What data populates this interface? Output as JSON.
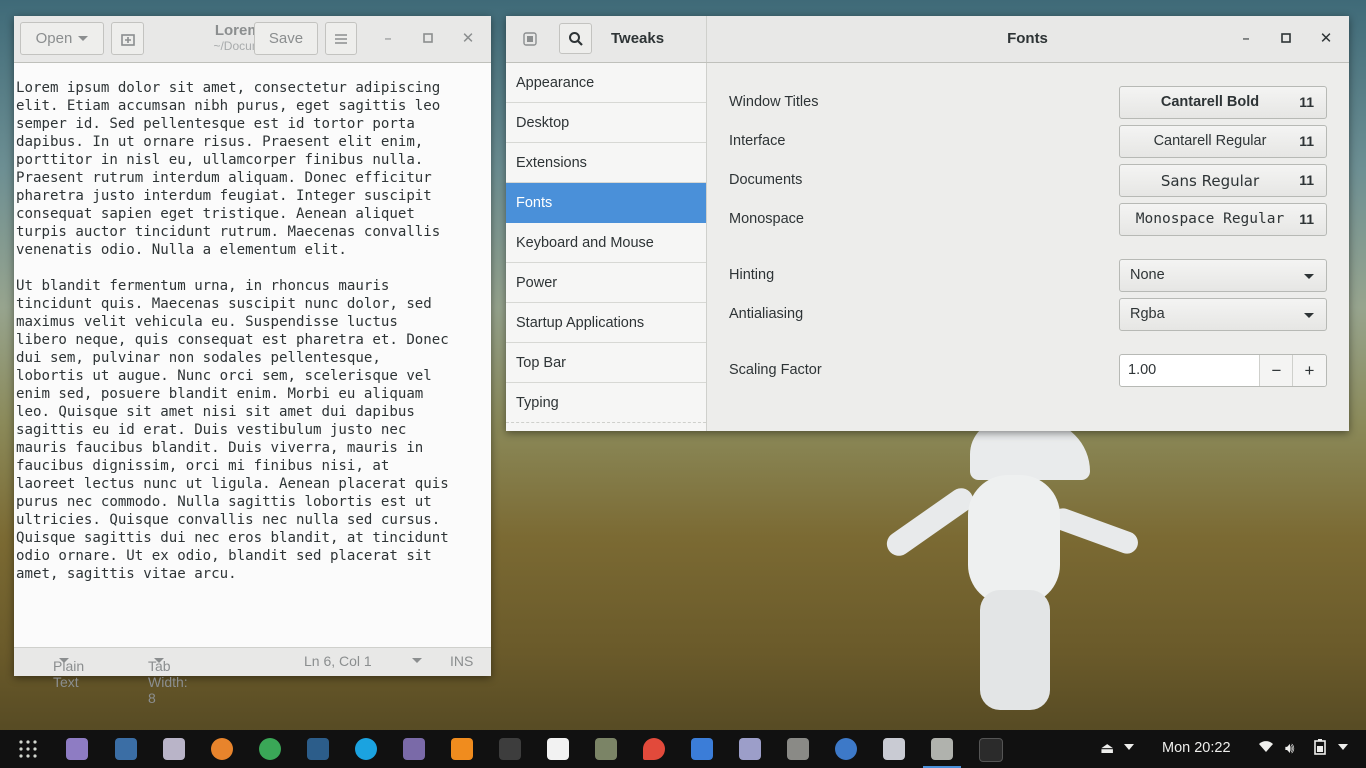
{
  "gedit": {
    "open_label": "Open",
    "save_label": "Save",
    "file_name": "Lorem.txt",
    "file_path": "~/Documents",
    "text": "Lorem ipsum dolor sit amet, consectetur adipiscing\nelit. Etiam accumsan nibh purus, eget sagittis leo\nsemper id. Sed pellentesque est id tortor porta\ndapibus. In ut ornare risus. Praesent elit enim,\nporttitor in nisl eu, ullamcorper finibus nulla.\nPraesent rutrum interdum aliquam. Donec efficitur\npharetra justo interdum feugiat. Integer suscipit\nconsequat sapien eget tristique. Aenean aliquet\nturpis auctor tincidunt rutrum. Maecenas convallis\nvenenatis odio. Nulla a elementum elit.\n\nUt blandit fermentum urna, in rhoncus mauris\ntincidunt quis. Maecenas suscipit nunc dolor, sed\nmaximus velit vehicula eu. Suspendisse luctus\nlibero neque, quis consequat est pharetra et. Donec\ndui sem, pulvinar non sodales pellentesque,\nlobortis ut augue. Nunc orci sem, scelerisque vel\nenim sed, posuere blandit enim. Morbi eu aliquam\nleo. Quisque sit amet nisi sit amet dui dapibus\nsagittis eu id erat. Duis vestibulum justo nec\nmauris faucibus blandit. Duis viverra, mauris in\nfaucibus dignissim, orci mi finibus nisi, at\nlaoreet lectus nunc ut ligula. Aenean placerat quis\npurus nec commodo. Nulla sagittis lobortis est ut\nultricies. Quisque convallis nec nulla sed cursus.\nQuisque sagittis dui nec eros blandit, at tincidunt\nodio ornare. Ut ex odio, blandit sed placerat sit\namet, sagittis vitae arcu.",
    "status": {
      "language": "Plain Text",
      "tab_width": "Tab Width: 8",
      "position": "Ln 6, Col 1",
      "mode": "INS"
    }
  },
  "tweaks": {
    "app_title": "Tweaks",
    "page_title": "Fonts",
    "sidebar": [
      "Appearance",
      "Desktop",
      "Extensions",
      "Fonts",
      "Keyboard and Mouse",
      "Power",
      "Startup Applications",
      "Top Bar",
      "Typing"
    ],
    "active_item": "Fonts",
    "fonts": [
      {
        "label": "Window Titles",
        "font": "Cantarell Bold",
        "size": "11"
      },
      {
        "label": "Interface",
        "font": "Cantarell Regular",
        "size": "11"
      },
      {
        "label": "Documents",
        "font": "Sans Regular",
        "size": "11"
      },
      {
        "label": "Monospace",
        "font": "Monospace Regular",
        "size": "11"
      }
    ],
    "hinting": {
      "label": "Hinting",
      "value": "None"
    },
    "antialiasing": {
      "label": "Antialiasing",
      "value": "Rgba"
    },
    "scaling": {
      "label": "Scaling Factor",
      "value": "1.00"
    }
  },
  "taskbar": {
    "clock": "Mon 20:22",
    "apps": [
      "apps-grid-icon",
      "purple-app-icon",
      "screenshot-icon",
      "files-icon",
      "firefox-icon",
      "chrome-icon",
      "steam-icon",
      "skype-icon",
      "gimp-icon",
      "vlc-icon",
      "video-player-icon",
      "music-icon",
      "pidgin-icon",
      "maps-icon",
      "document-icon",
      "notes-icon",
      "tweaks-icon",
      "web-icon",
      "settings-icon",
      "keyboard-icon",
      "terminal-icon"
    ]
  },
  "colors": {
    "accent": "#4a90d9",
    "headerbar": "#e8e8e7",
    "taskbar": "#111111"
  }
}
